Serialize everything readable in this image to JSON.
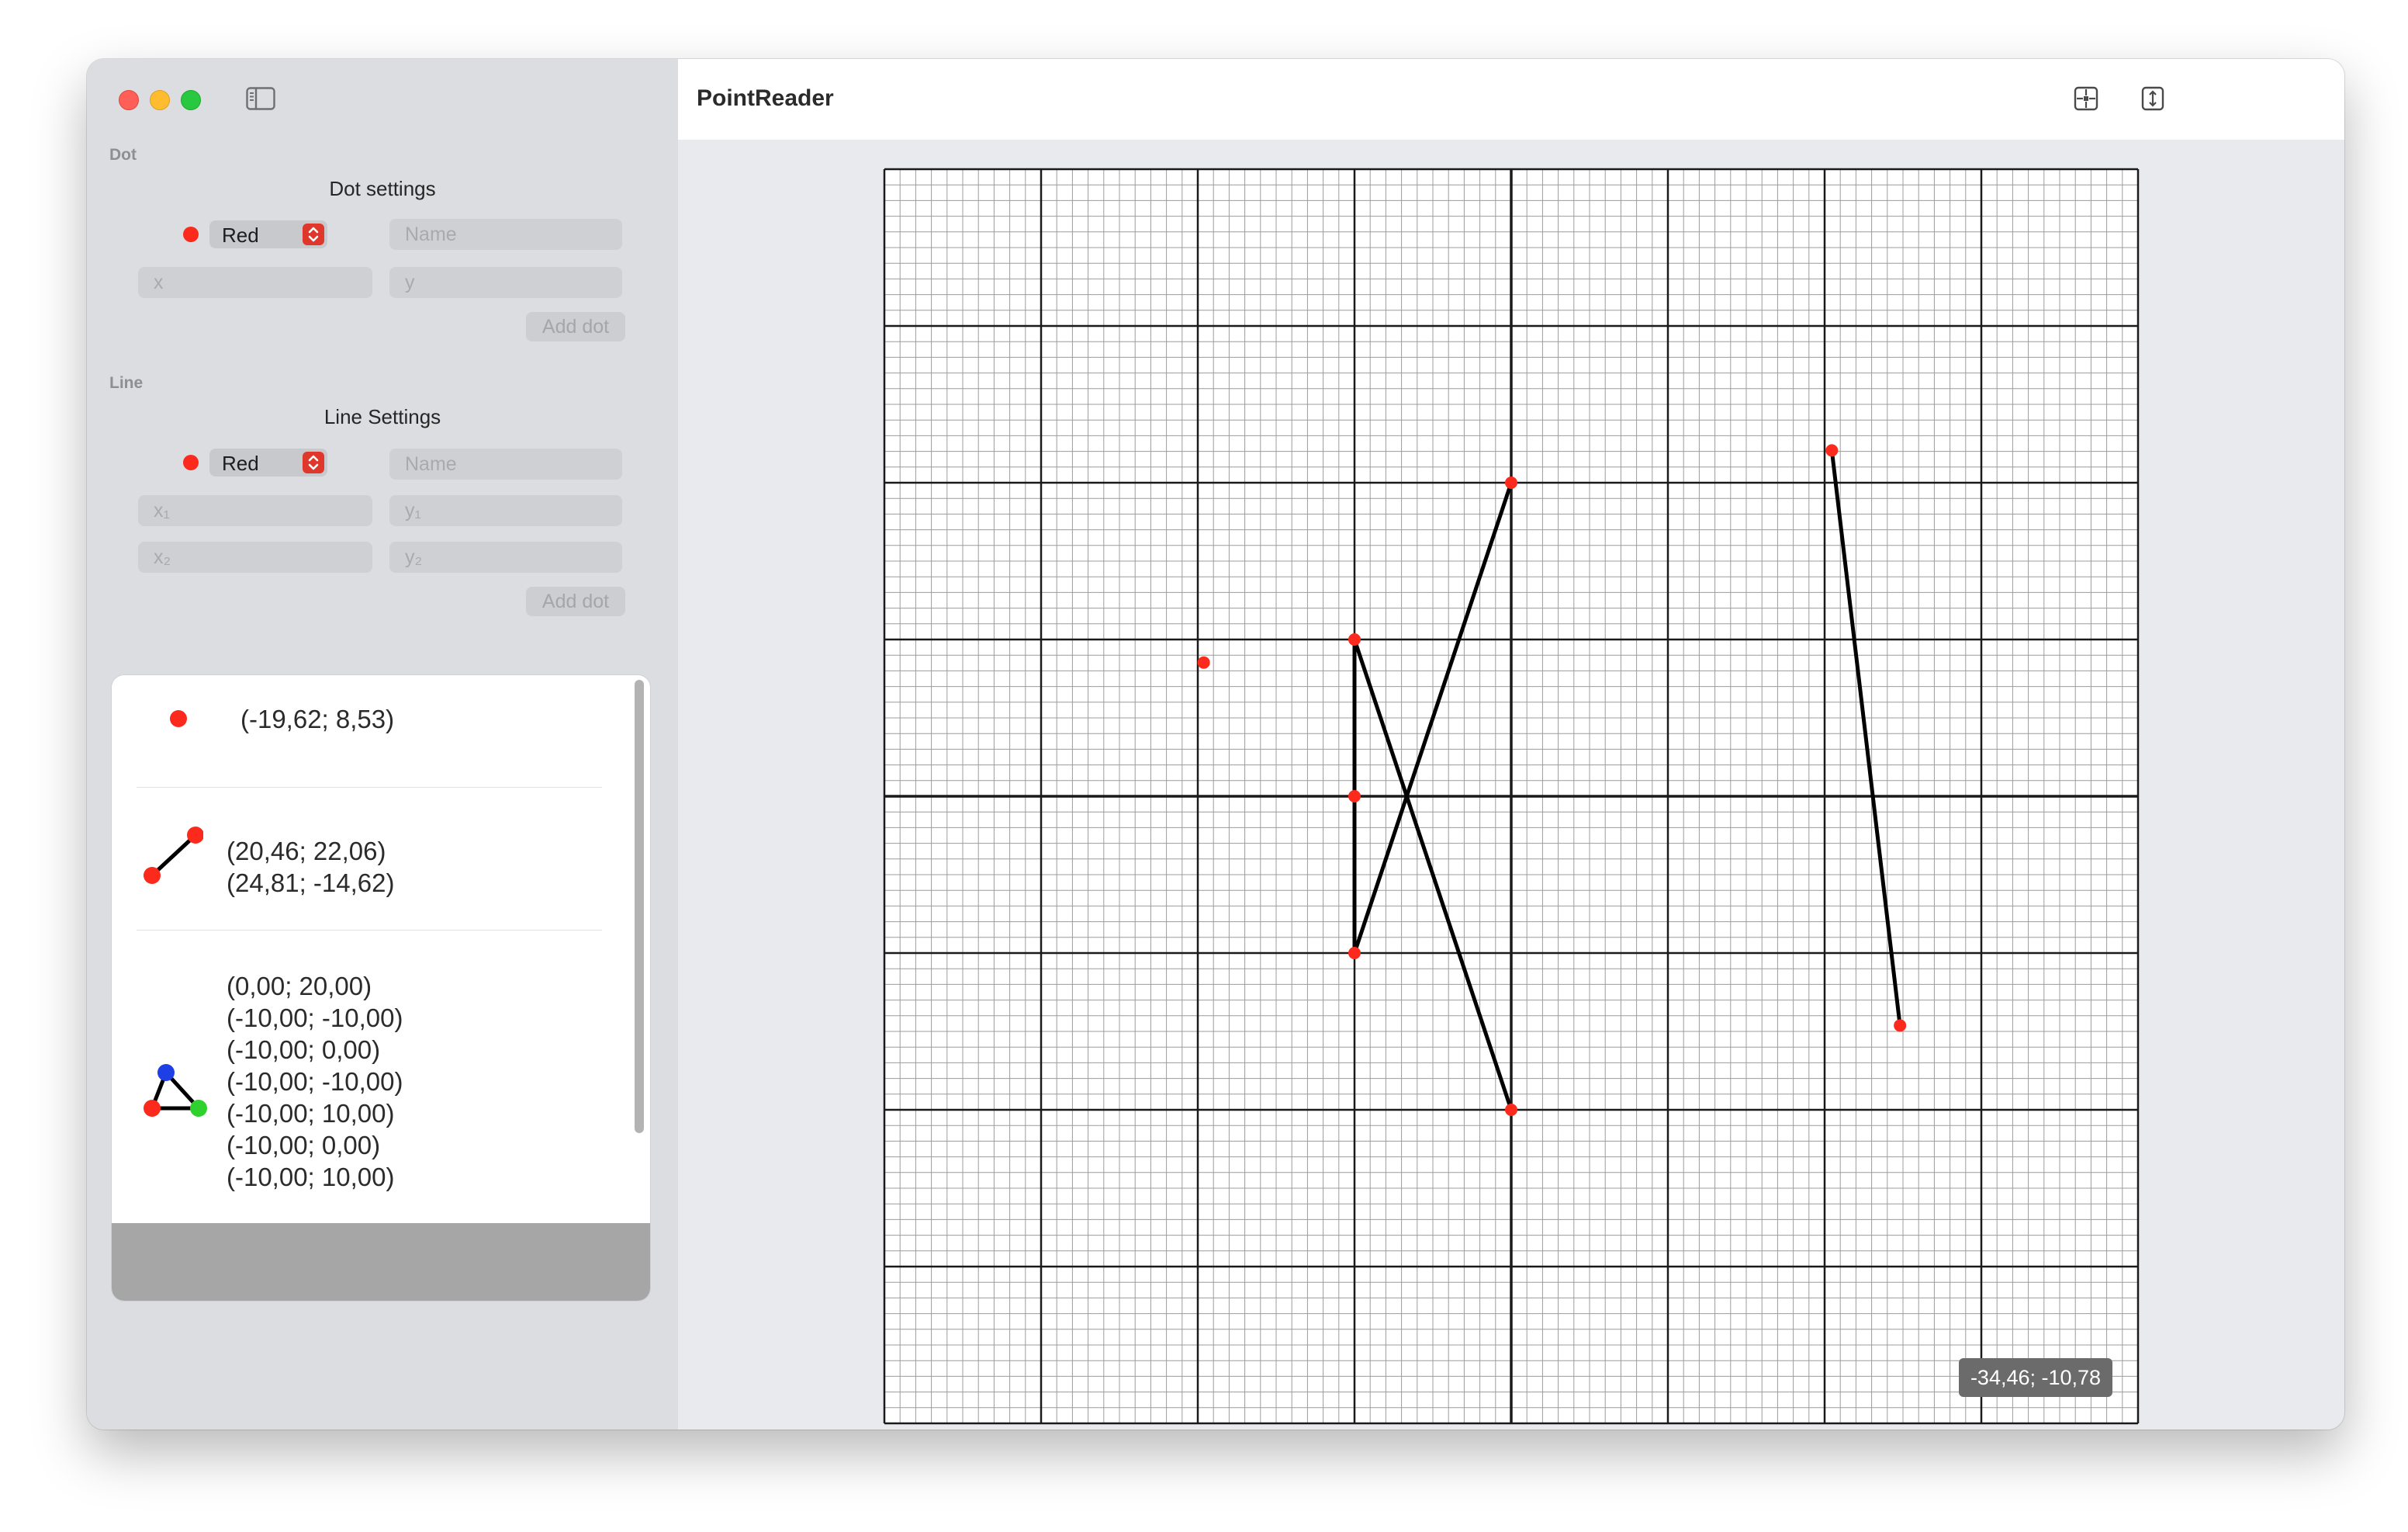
{
  "window": {
    "title": "PointReader"
  },
  "sidebar": {
    "dot": {
      "caption": "Dot",
      "title": "Dot settings",
      "color_label": "Red",
      "name_placeholder": "Name",
      "x_placeholder": "x",
      "y_placeholder": "y",
      "add_label": "Add dot"
    },
    "line": {
      "caption": "Line",
      "title": "Line Settings",
      "color_label": "Red",
      "name_placeholder": "Name",
      "x1_placeholder": "x₁",
      "y1_placeholder": "y₁",
      "x2_placeholder": "x₂",
      "y2_placeholder": "y₂",
      "add_label": "Add dot"
    },
    "list": {
      "dot_item": {
        "coords": "(-19,62; 8,53)"
      },
      "line_item": {
        "p1": "(20,46; 22,06)",
        "p2": "(24,81; -14,62)"
      },
      "shape_item": {
        "points": [
          "(0,00; 20,00)",
          "(-10,00; -10,00)",
          "(-10,00; 0,00)",
          "(-10,00; -10,00)",
          "(-10,00; 10,00)",
          "(-10,00; 0,00)",
          "(-10,00; 10,00)"
        ]
      }
    }
  },
  "toolbar": {
    "icons": [
      "center-view-icon",
      "fit-vertical-icon"
    ]
  },
  "grid": {
    "x_range": [
      -40,
      40
    ],
    "y_range": [
      -40,
      40
    ],
    "minor_step": 1,
    "major_step": 10,
    "cursor_readout": "-34,46; -10,78"
  },
  "plot": {
    "dots": [
      {
        "x": -19.62,
        "y": 8.53,
        "color": "#fc2a1c"
      }
    ],
    "segments": [
      {
        "from": [
          20.46,
          22.06
        ],
        "to": [
          24.81,
          -14.62
        ]
      },
      {
        "from": [
          0,
          20
        ],
        "to": [
          -10,
          -10
        ]
      },
      {
        "from": [
          -10,
          -10
        ],
        "to": [
          -10,
          0
        ]
      },
      {
        "from": [
          -10,
          0
        ],
        "to": [
          -10,
          -10
        ]
      },
      {
        "from": [
          -10,
          -10
        ],
        "to": [
          -10,
          10
        ]
      },
      {
        "from": [
          -10,
          10
        ],
        "to": [
          -10,
          0
        ]
      },
      {
        "from": [
          -10,
          0
        ],
        "to": [
          -10,
          10
        ]
      },
      {
        "from": [
          -10,
          10
        ],
        "to": [
          0,
          -20
        ]
      }
    ],
    "vertices": [
      [
        20.46,
        22.06
      ],
      [
        24.81,
        -14.62
      ],
      [
        0,
        20
      ],
      [
        -10,
        -10
      ],
      [
        -10,
        0
      ],
      [
        -10,
        10
      ],
      [
        0,
        -20
      ]
    ],
    "point_color": "#fc2a1c",
    "line_color": "#000000"
  },
  "colors": {
    "accent_red": "#fc2a1c",
    "shape_blue": "#1f3fe6",
    "shape_green": "#2ed12e"
  }
}
